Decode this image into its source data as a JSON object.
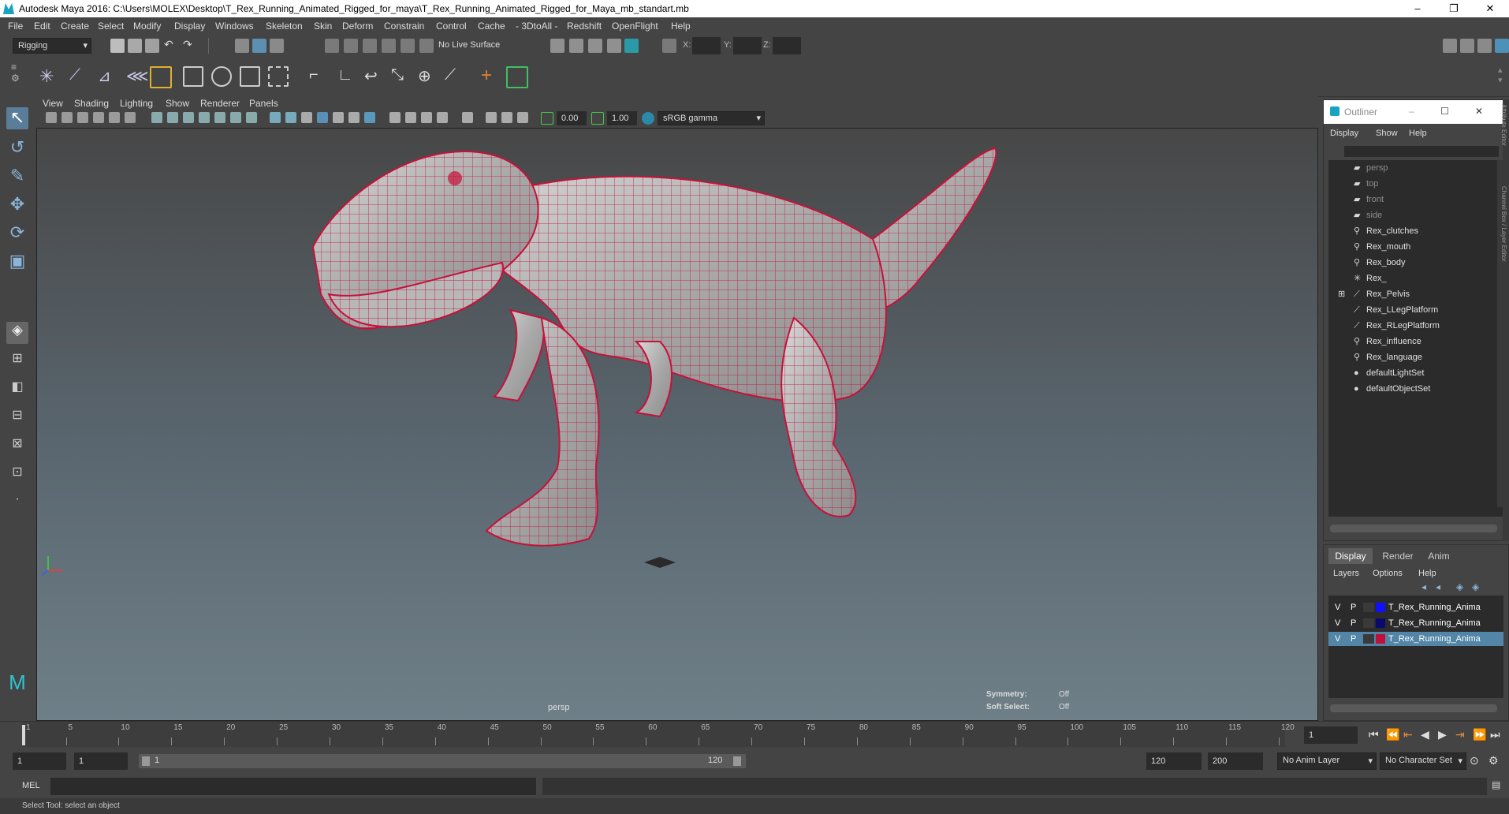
{
  "title": "Autodesk Maya 2016: C:\\Users\\MOLEX\\Desktop\\T_Rex_Running_Animated_Rigged_for_maya\\T_Rex_Running_Animated_Rigged_for_Maya_mb_standart.mb",
  "window_controls": {
    "minimize": "–",
    "maximize": "❐",
    "close": "✕"
  },
  "menu": [
    "File",
    "Edit",
    "Create",
    "Select",
    "Modify",
    "Display",
    "Windows",
    "Skeleton",
    "Skin",
    "Deform",
    "Constrain",
    "Control",
    "Cache",
    "- 3DtoAll -",
    "Redshift",
    "OpenFlight",
    "Help"
  ],
  "status_line": {
    "mode": "Rigging",
    "live_surface": "No Live Surface",
    "x_label": "X:",
    "y_label": "Y:",
    "z_label": "Z:"
  },
  "viewport": {
    "menu": [
      "View",
      "Shading",
      "Lighting",
      "Show",
      "Renderer",
      "Panels"
    ],
    "near_value": "0.00",
    "far_value": "1.00",
    "color_space": "sRGB gamma",
    "camera_label": "persp",
    "symmetry_label": "Symmetry:",
    "symmetry_value": "Off",
    "soft_select_label": "Soft Select:",
    "soft_select_value": "Off",
    "mesh_color": "#c8103a"
  },
  "outliner": {
    "title": "Outliner",
    "menu": [
      "Display",
      "Show",
      "Help"
    ],
    "items": [
      {
        "label": "persp",
        "icon": "camera-icon",
        "type": "cam"
      },
      {
        "label": "top",
        "icon": "camera-icon",
        "type": "cam"
      },
      {
        "label": "front",
        "icon": "camera-icon",
        "type": "cam"
      },
      {
        "label": "side",
        "icon": "camera-icon",
        "type": "cam"
      },
      {
        "label": "Rex_clutches",
        "icon": "mesh-icon",
        "type": "obj"
      },
      {
        "label": "Rex_mouth",
        "icon": "mesh-icon",
        "type": "obj"
      },
      {
        "label": "Rex_body",
        "icon": "mesh-icon",
        "type": "obj"
      },
      {
        "label": "Rex_",
        "icon": "locator-icon",
        "type": "obj"
      },
      {
        "label": "Rex_Pelvis",
        "icon": "joint-icon",
        "type": "obj"
      },
      {
        "label": "Rex_LLegPlatform",
        "icon": "joint-icon",
        "type": "obj"
      },
      {
        "label": "Rex_RLegPlatform",
        "icon": "joint-icon",
        "type": "obj"
      },
      {
        "label": "Rex_influence",
        "icon": "mesh-icon",
        "type": "obj"
      },
      {
        "label": "Rex_language",
        "icon": "mesh-icon",
        "type": "obj"
      },
      {
        "label": "defaultLightSet",
        "icon": "set-icon",
        "type": "obj"
      },
      {
        "label": "defaultObjectSet",
        "icon": "set-icon",
        "type": "obj"
      }
    ]
  },
  "side_tabs": "Channel Box / Layer Editor",
  "side_tabs_top": "Attribute Editor",
  "layers": {
    "tabs": [
      "Display",
      "Render",
      "Anim"
    ],
    "menu": [
      "Layers",
      "Options",
      "Help"
    ],
    "rows": [
      {
        "v": "V",
        "p": "P",
        "color": "#1010ff",
        "name": "T_Rex_Running_Anima"
      },
      {
        "v": "V",
        "p": "P",
        "color": "#0a0a6e",
        "name": "T_Rex_Running_Anima"
      },
      {
        "v": "V",
        "p": "P",
        "color": "#c0103a",
        "name": "T_Rex_Running_Anima"
      }
    ]
  },
  "timeline": {
    "ticks": [
      "1",
      "5",
      "10",
      "15",
      "20",
      "25",
      "30",
      "35",
      "40",
      "45",
      "50",
      "55",
      "60",
      "65",
      "70",
      "75",
      "80",
      "85",
      "90",
      "95",
      "100",
      "105",
      "110",
      "115",
      "120"
    ],
    "current_frame": "1"
  },
  "range": {
    "start": "1",
    "playback_start": "1",
    "slider_start": "1",
    "slider_end": "120",
    "playback_end": "120",
    "end": "200",
    "anim_layer": "No Anim Layer",
    "character_set": "No Character Set"
  },
  "command": {
    "label": "MEL"
  },
  "help_line": "Select Tool: select an object"
}
